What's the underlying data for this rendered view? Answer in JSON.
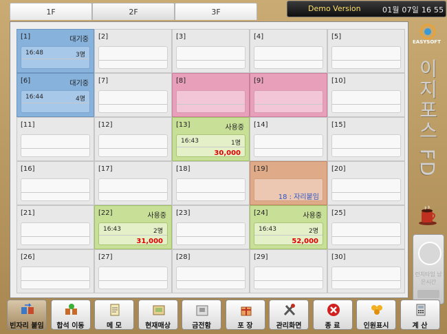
{
  "tabs": [
    "1F",
    "2F",
    "3F"
  ],
  "status": {
    "demo": "Demo Version",
    "datetime": "01월 07일 16  55"
  },
  "tables": [
    {
      "num": "[1]",
      "state": "대기중",
      "color": "blue",
      "time": "16:48",
      "people": "3명"
    },
    {
      "num": "[2]"
    },
    {
      "num": "[3]"
    },
    {
      "num": "[4]"
    },
    {
      "num": "[5]"
    },
    {
      "num": "[6]",
      "state": "대기중",
      "color": "blue",
      "time": "16:44",
      "people": "4명"
    },
    {
      "num": "[7]"
    },
    {
      "num": "[8]",
      "color": "pink"
    },
    {
      "num": "[9]",
      "color": "pink"
    },
    {
      "num": "[10]"
    },
    {
      "num": "[11]"
    },
    {
      "num": "[12]"
    },
    {
      "num": "[13]",
      "state": "사용중",
      "color": "green",
      "time": "16:43",
      "people": "1명",
      "amount": "30,000"
    },
    {
      "num": "[14]"
    },
    {
      "num": "[15]"
    },
    {
      "num": "[16]"
    },
    {
      "num": "[17]"
    },
    {
      "num": "[18]"
    },
    {
      "num": "[19]",
      "color": "orange",
      "message": "18 : 자리붙임"
    },
    {
      "num": "[20]"
    },
    {
      "num": "[21]"
    },
    {
      "num": "[22]",
      "state": "사용중",
      "color": "green",
      "time": "16:43",
      "people": "2명",
      "amount": "31,000"
    },
    {
      "num": "[23]"
    },
    {
      "num": "[24]",
      "state": "사용중",
      "color": "green",
      "time": "16:43",
      "people": "2명",
      "amount": "52,000"
    },
    {
      "num": "[25]"
    },
    {
      "num": "[26]"
    },
    {
      "num": "[27]"
    },
    {
      "num": "[28]"
    },
    {
      "num": "[29]"
    },
    {
      "num": "[30]"
    }
  ],
  "side": {
    "logo_text": "EASYSOFT",
    "title": "이지포스 FD",
    "timer_label": "런치타임 남은시간"
  },
  "buttons": [
    {
      "label": "빈자리 붙임",
      "icon": "merge-table-icon",
      "active": true
    },
    {
      "label": "합석 이동",
      "icon": "move-table-icon"
    },
    {
      "label": "메 모",
      "icon": "memo-icon"
    },
    {
      "label": "현재매상",
      "icon": "sales-icon"
    },
    {
      "label": "금전함",
      "icon": "cash-drawer-icon"
    },
    {
      "label": "포 장",
      "icon": "package-icon"
    },
    {
      "label": "관리화면",
      "icon": "tools-icon"
    },
    {
      "label": "종 료",
      "icon": "close-icon"
    },
    {
      "label": "인원표시",
      "icon": "people-icon"
    },
    {
      "label": "계 산",
      "icon": "calculator-icon"
    }
  ]
}
